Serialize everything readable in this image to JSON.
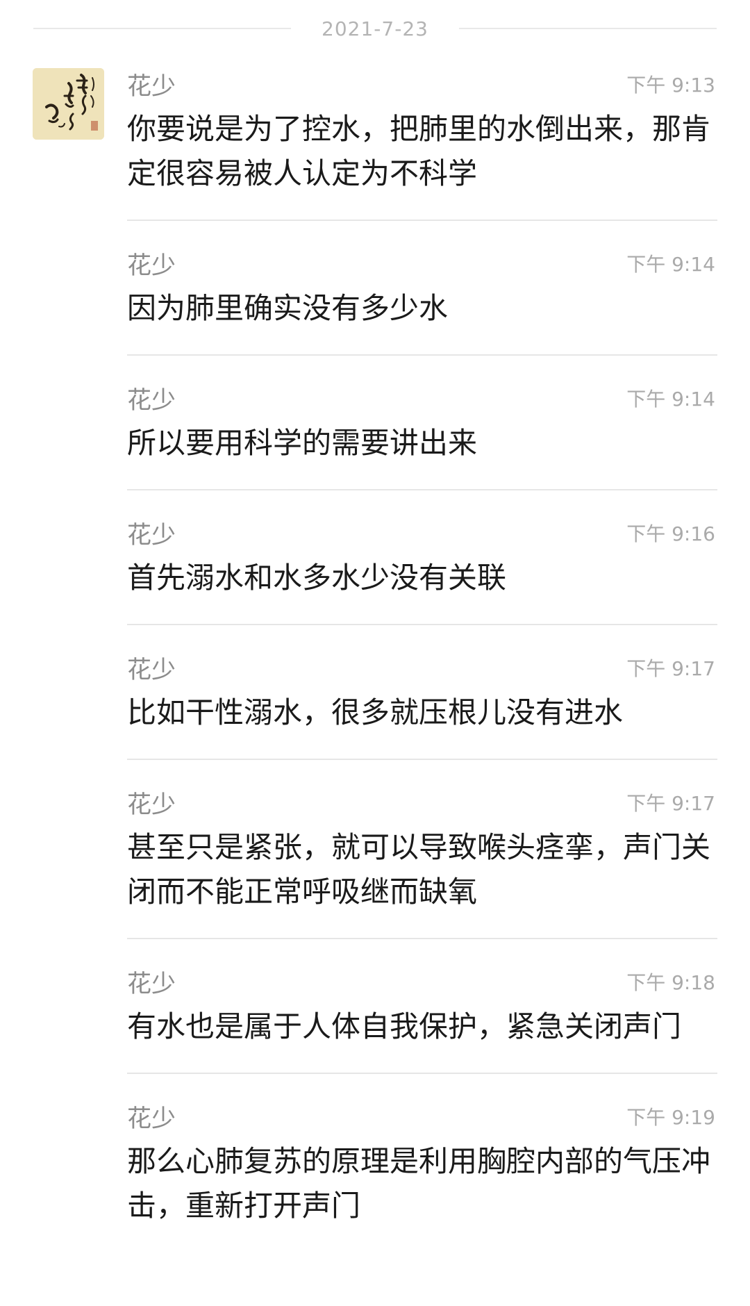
{
  "date": "2021-7-23",
  "messages": [
    {
      "sender": "花少",
      "time": "下午 9:13",
      "text": "你要说是为了控水，把肺里的水倒出来，那肯定很容易被人认定为不科学"
    },
    {
      "sender": "花少",
      "time": "下午 9:14",
      "text": "因为肺里确实没有多少水"
    },
    {
      "sender": "花少",
      "time": "下午 9:14",
      "text": "所以要用科学的需要讲出来"
    },
    {
      "sender": "花少",
      "time": "下午 9:16",
      "text": "首先溺水和水多水少没有关联"
    },
    {
      "sender": "花少",
      "time": "下午 9:17",
      "text": "比如干性溺水，很多就压根儿没有进水"
    },
    {
      "sender": "花少",
      "time": "下午 9:17",
      "text": "甚至只是紧张，就可以导致喉头痉挛，声门关闭而不能正常呼吸继而缺氧"
    },
    {
      "sender": "花少",
      "time": "下午 9:18",
      "text": "有水也是属于人体自我保护，紧急关闭声门"
    },
    {
      "sender": "花少",
      "time": "下午 9:19",
      "text": "那么心肺复苏的原理是利用胸腔内部的气压冲击，重新打开声门"
    }
  ]
}
